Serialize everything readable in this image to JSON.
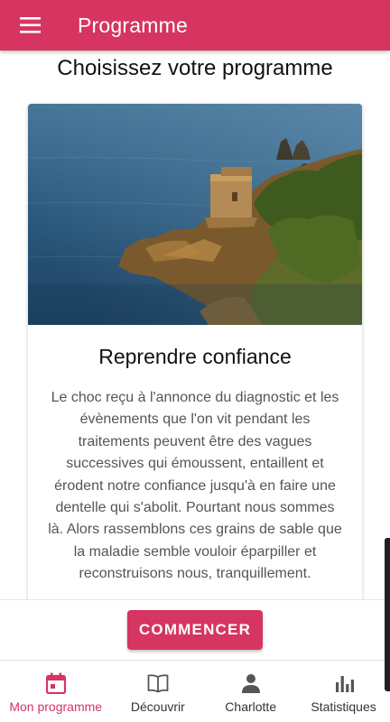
{
  "app_bar": {
    "title": "Programme",
    "menu_icon": "menu-icon",
    "color": "#d63461"
  },
  "main": {
    "heading": "Choisissez votre programme",
    "card": {
      "image": "coastal-tower-landscape",
      "title": "Reprendre confiance",
      "description": "Le choc reçu à l'annonce du diagnostic et les évènements que l'on vit pendant les traitements peuvent être des vagues successives qui émoussent, entaillent et érodent notre confiance jusqu'à en faire une dentelle qui s'abolit. Pourtant nous sommes là. Alors rassemblons ces grains de sable que la maladie semble vouloir éparpiller et reconstruisons nous, tranquillement."
    },
    "start_button": "COMMENCER"
  },
  "bottom_nav": {
    "items": [
      {
        "label": "Mon programme",
        "icon": "calendar-icon",
        "active": true
      },
      {
        "label": "Découvrir",
        "icon": "book-icon",
        "active": false
      },
      {
        "label": "Charlotte",
        "icon": "person-icon",
        "active": false
      },
      {
        "label": "Statistiques",
        "icon": "bar-chart-icon",
        "active": false
      }
    ]
  },
  "colors": {
    "accent": "#d63461",
    "text_secondary": "#555555"
  }
}
